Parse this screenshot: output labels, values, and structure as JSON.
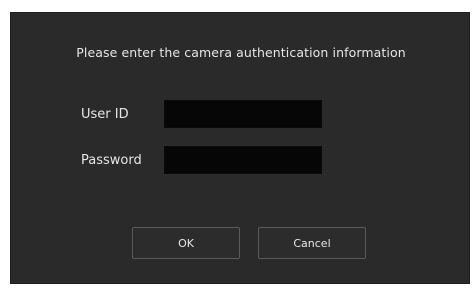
{
  "dialog": {
    "title": "Please enter the camera authentication information",
    "user_id_label": "User ID",
    "user_id_value": "",
    "password_label": "Password",
    "password_value": "",
    "ok_label": "OK",
    "cancel_label": "Cancel"
  },
  "colors": {
    "dialog_bg": "#2a2a2a",
    "field_bg": "#060606",
    "text": "#e6e6e6",
    "button_border": "#5a5a5a"
  }
}
